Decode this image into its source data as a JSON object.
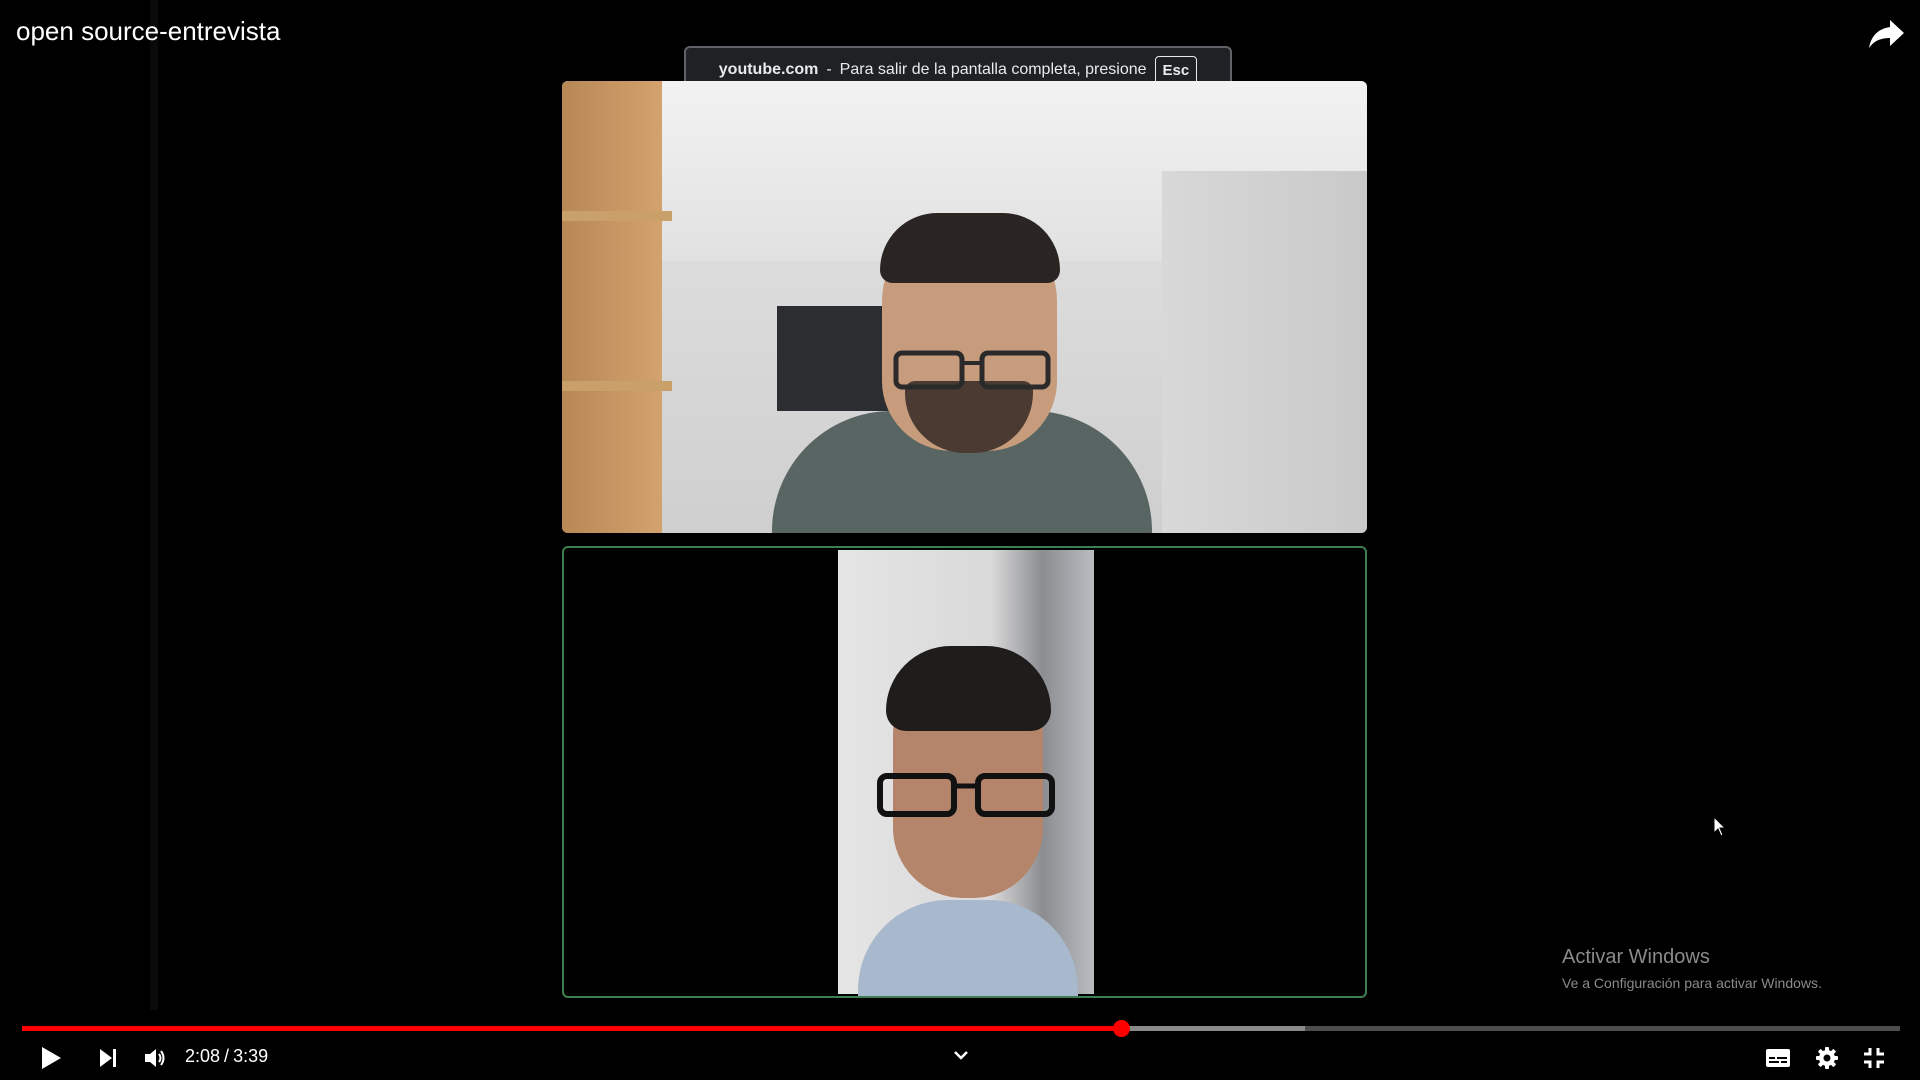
{
  "video": {
    "title": "open source-entrevista",
    "current_time": "2:08",
    "duration": "3:39",
    "played_fraction": 0.585,
    "buffered_fraction": 0.683
  },
  "toast": {
    "domain": "youtube.com",
    "separator": "-",
    "message": "Para salir de la pantalla completa, presione",
    "key": "Esc"
  },
  "watermark": {
    "line1": "Activar Windows",
    "line2": "Ve a Configuración para activar Windows."
  },
  "colors": {
    "accent": "#ff0000",
    "tile_border": "#3f7d52",
    "background": "#000000"
  },
  "icons": {
    "share": "share-icon",
    "play": "play-icon",
    "next": "next-icon",
    "volume": "volume-icon",
    "chevron": "chevron-down-icon",
    "subtitles": "subtitles-icon",
    "settings": "gear-icon",
    "exit_fullscreen": "exit-fullscreen-icon"
  }
}
